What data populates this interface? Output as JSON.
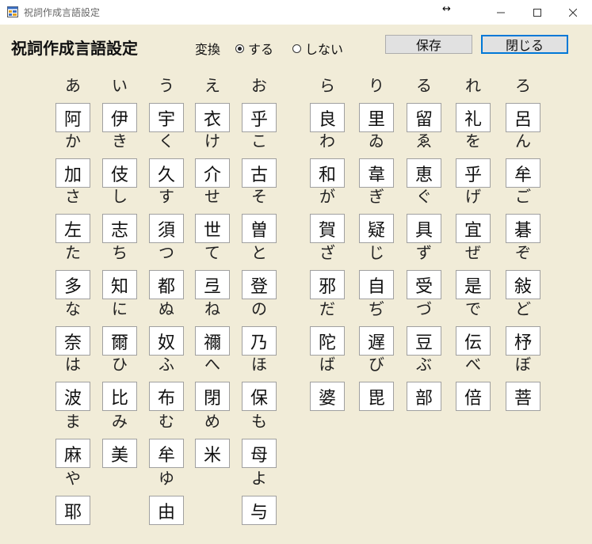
{
  "window": {
    "title": "祝詞作成言語設定"
  },
  "header": {
    "heading": "祝詞作成言語設定",
    "conversion_label": "変換",
    "radio_on_label": "する",
    "radio_off_label": "しない",
    "selected": "する",
    "save_button": "保存",
    "close_button": "閉じる"
  },
  "left_grid": [
    [
      {
        "kana": "あ",
        "kanji": "阿"
      },
      {
        "kana": "い",
        "kanji": "伊"
      },
      {
        "kana": "う",
        "kanji": "宇"
      },
      {
        "kana": "え",
        "kanji": "衣"
      },
      {
        "kana": "お",
        "kanji": "乎"
      }
    ],
    [
      {
        "kana": "か",
        "kanji": "加"
      },
      {
        "kana": "き",
        "kanji": "伎"
      },
      {
        "kana": "く",
        "kanji": "久"
      },
      {
        "kana": "け",
        "kanji": "介"
      },
      {
        "kana": "こ",
        "kanji": "古"
      }
    ],
    [
      {
        "kana": "さ",
        "kanji": "左"
      },
      {
        "kana": "し",
        "kanji": "志"
      },
      {
        "kana": "す",
        "kanji": "須"
      },
      {
        "kana": "せ",
        "kanji": "世"
      },
      {
        "kana": "そ",
        "kanji": "曽"
      }
    ],
    [
      {
        "kana": "た",
        "kanji": "多"
      },
      {
        "kana": "ち",
        "kanji": "知"
      },
      {
        "kana": "つ",
        "kanji": "都"
      },
      {
        "kana": "て",
        "kanji": "弖"
      },
      {
        "kana": "と",
        "kanji": "登"
      }
    ],
    [
      {
        "kana": "な",
        "kanji": "奈"
      },
      {
        "kana": "に",
        "kanji": "爾"
      },
      {
        "kana": "ぬ",
        "kanji": "奴"
      },
      {
        "kana": "ね",
        "kanji": "禰"
      },
      {
        "kana": "の",
        "kanji": "乃"
      }
    ],
    [
      {
        "kana": "は",
        "kanji": "波"
      },
      {
        "kana": "ひ",
        "kanji": "比"
      },
      {
        "kana": "ふ",
        "kanji": "布"
      },
      {
        "kana": "へ",
        "kanji": "閉"
      },
      {
        "kana": "ほ",
        "kanji": "保"
      }
    ],
    [
      {
        "kana": "ま",
        "kanji": "麻"
      },
      {
        "kana": "み",
        "kanji": "美"
      },
      {
        "kana": "む",
        "kanji": "牟"
      },
      {
        "kana": "め",
        "kanji": "米"
      },
      {
        "kana": "も",
        "kanji": "母"
      }
    ],
    [
      {
        "kana": "や",
        "kanji": "耶"
      },
      null,
      {
        "kana": "ゆ",
        "kanji": "由"
      },
      null,
      {
        "kana": "よ",
        "kanji": "与"
      }
    ]
  ],
  "right_grid": [
    [
      {
        "kana": "ら",
        "kanji": "良"
      },
      {
        "kana": "り",
        "kanji": "里"
      },
      {
        "kana": "る",
        "kanji": "留"
      },
      {
        "kana": "れ",
        "kanji": "礼"
      },
      {
        "kana": "ろ",
        "kanji": "呂"
      }
    ],
    [
      {
        "kana": "わ",
        "kanji": "和"
      },
      {
        "kana": "ゐ",
        "kanji": "韋"
      },
      {
        "kana": "ゑ",
        "kanji": "恵"
      },
      {
        "kana": "を",
        "kanji": "乎"
      },
      {
        "kana": "ん",
        "kanji": "牟"
      }
    ],
    [
      {
        "kana": "が",
        "kanji": "賀"
      },
      {
        "kana": "ぎ",
        "kanji": "疑"
      },
      {
        "kana": "ぐ",
        "kanji": "具"
      },
      {
        "kana": "げ",
        "kanji": "宜"
      },
      {
        "kana": "ご",
        "kanji": "碁"
      }
    ],
    [
      {
        "kana": "ざ",
        "kanji": "邪"
      },
      {
        "kana": "じ",
        "kanji": "自"
      },
      {
        "kana": "ず",
        "kanji": "受"
      },
      {
        "kana": "ぜ",
        "kanji": "是"
      },
      {
        "kana": "ぞ",
        "kanji": "敍"
      }
    ],
    [
      {
        "kana": "だ",
        "kanji": "陀"
      },
      {
        "kana": "ぢ",
        "kanji": "遅"
      },
      {
        "kana": "づ",
        "kanji": "豆"
      },
      {
        "kana": "で",
        "kanji": "伝"
      },
      {
        "kana": "ど",
        "kanji": "杼"
      }
    ],
    [
      {
        "kana": "ば",
        "kanji": "婆"
      },
      {
        "kana": "び",
        "kanji": "毘"
      },
      {
        "kana": "ぶ",
        "kanji": "部"
      },
      {
        "kana": "べ",
        "kanji": "倍"
      },
      {
        "kana": "ぼ",
        "kanji": "菩"
      }
    ]
  ]
}
